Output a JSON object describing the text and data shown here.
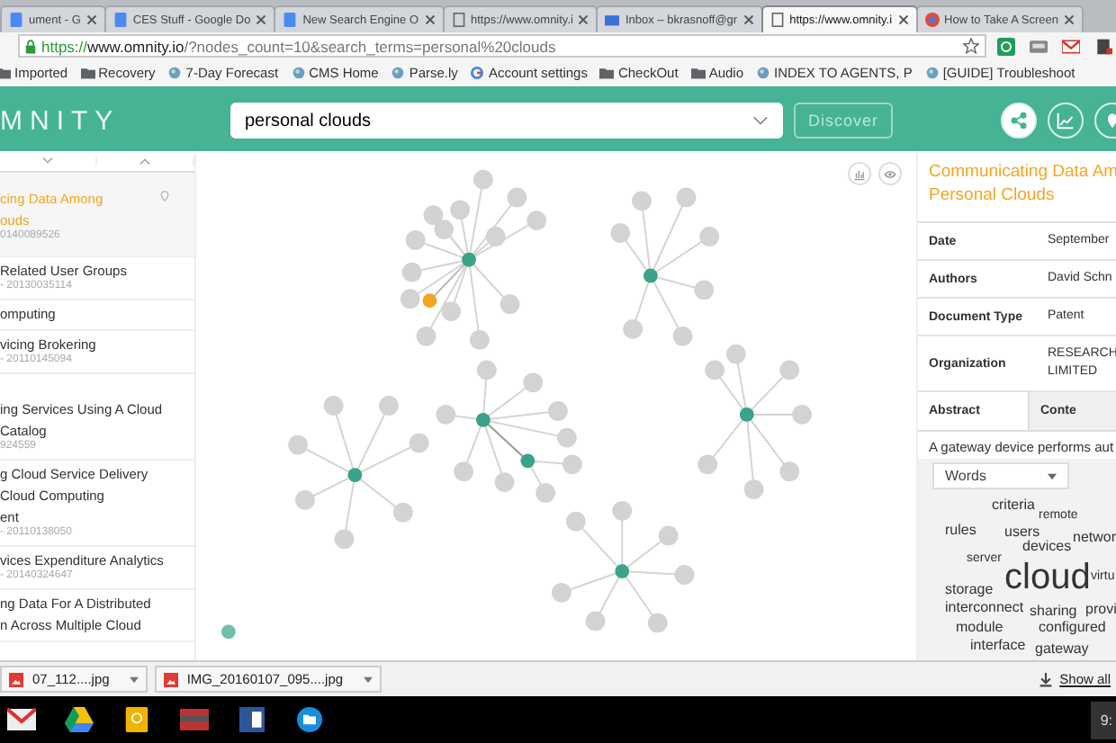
{
  "browser_tabs": [
    {
      "title": "ument - G",
      "selected": false
    },
    {
      "title": "CES Stuff - Google Do",
      "selected": false
    },
    {
      "title": "New Search Engine O",
      "selected": false
    },
    {
      "title": "https://www.omnity.i",
      "selected": false
    },
    {
      "title": "Inbox – bkrasnoff@gr",
      "selected": false
    },
    {
      "title": "https://www.omnity.i",
      "selected": true
    },
    {
      "title": "How to Take A Screen",
      "selected": false
    }
  ],
  "address": {
    "scheme": "https://",
    "host": "www.omnity.io",
    "path": "/?nodes_count=10&search_terms=personal%20clouds"
  },
  "bookmarks": [
    {
      "label": "Imported",
      "kind": "folder"
    },
    {
      "label": "Recovery",
      "kind": "folder"
    },
    {
      "label": "7-Day Forecast",
      "kind": "site"
    },
    {
      "label": "CMS Home",
      "kind": "site"
    },
    {
      "label": "Parse.ly",
      "kind": "site"
    },
    {
      "label": "Account settings",
      "kind": "google"
    },
    {
      "label": "CheckOut",
      "kind": "folder"
    },
    {
      "label": "Audio",
      "kind": "folder"
    },
    {
      "label": "INDEX TO AGENTS, P",
      "kind": "site"
    },
    {
      "label": "[GUIDE] Troubleshoot",
      "kind": "site"
    }
  ],
  "header": {
    "logo": "MNITY",
    "search": {
      "value": "personal clouds"
    },
    "discover_button": "Discover",
    "views": [
      {
        "selected": true
      },
      {
        "selected": false
      },
      {
        "selected": false
      }
    ]
  },
  "results": [
    {
      "title_lines": [
        "cing Data Among",
        "ouds"
      ],
      "number": "0140089526",
      "selected": true
    },
    {
      "title_lines": [
        "Related User Groups"
      ],
      "number": "- 20130035114",
      "selected": false
    },
    {
      "title_lines": [
        "omputing"
      ],
      "selected": false
    },
    {
      "title_lines": [
        "vicing Brokering"
      ],
      "number": "- 20110145094",
      "selected": false
    },
    {
      "title_lines": [
        "ing Services Using A Cloud",
        "Catalog"
      ],
      "number": "924559",
      "selected": false
    },
    {
      "title_lines": [
        "g Cloud Service Delivery",
        "Cloud Computing",
        "ent"
      ],
      "number": "- 20110138050",
      "selected": false
    },
    {
      "title_lines": [
        "vices Expenditure Analytics"
      ],
      "number": "- 20140324647",
      "selected": false
    },
    {
      "title_lines": [
        "ng Data For A Distributed",
        "n Across Multiple Cloud"
      ],
      "selected": false
    }
  ],
  "detail": {
    "title_lines": [
      "Communicating Data Am",
      "Personal Clouds"
    ],
    "fields": [
      {
        "label": "Date",
        "value": "September"
      },
      {
        "label": "Authors",
        "value": "David Schn"
      },
      {
        "label": "Document Type",
        "value": "Patent"
      },
      {
        "label": "Organization",
        "value": "RESEARCH\nLIMITED"
      }
    ],
    "tabs": [
      {
        "label": "Abstract",
        "selected": true
      },
      {
        "label": "Conte",
        "selected": false
      }
    ],
    "abstract": "A gateway device performs aut",
    "words_dropdown": "Words",
    "word_cloud": [
      "criteria",
      "remote",
      "rules",
      "users",
      "networ",
      "devices",
      "server",
      "cloud",
      "virtu",
      "storage",
      "interconnect",
      "sharing",
      "provi",
      "module",
      "configured",
      "interface",
      "gateway"
    ]
  },
  "downloads": [
    {
      "name": "07_112....jpg"
    },
    {
      "name": "IMG_20160107_095....jpg"
    }
  ],
  "show_all": "Show all",
  "taskbar": {
    "clock": "9:"
  }
}
